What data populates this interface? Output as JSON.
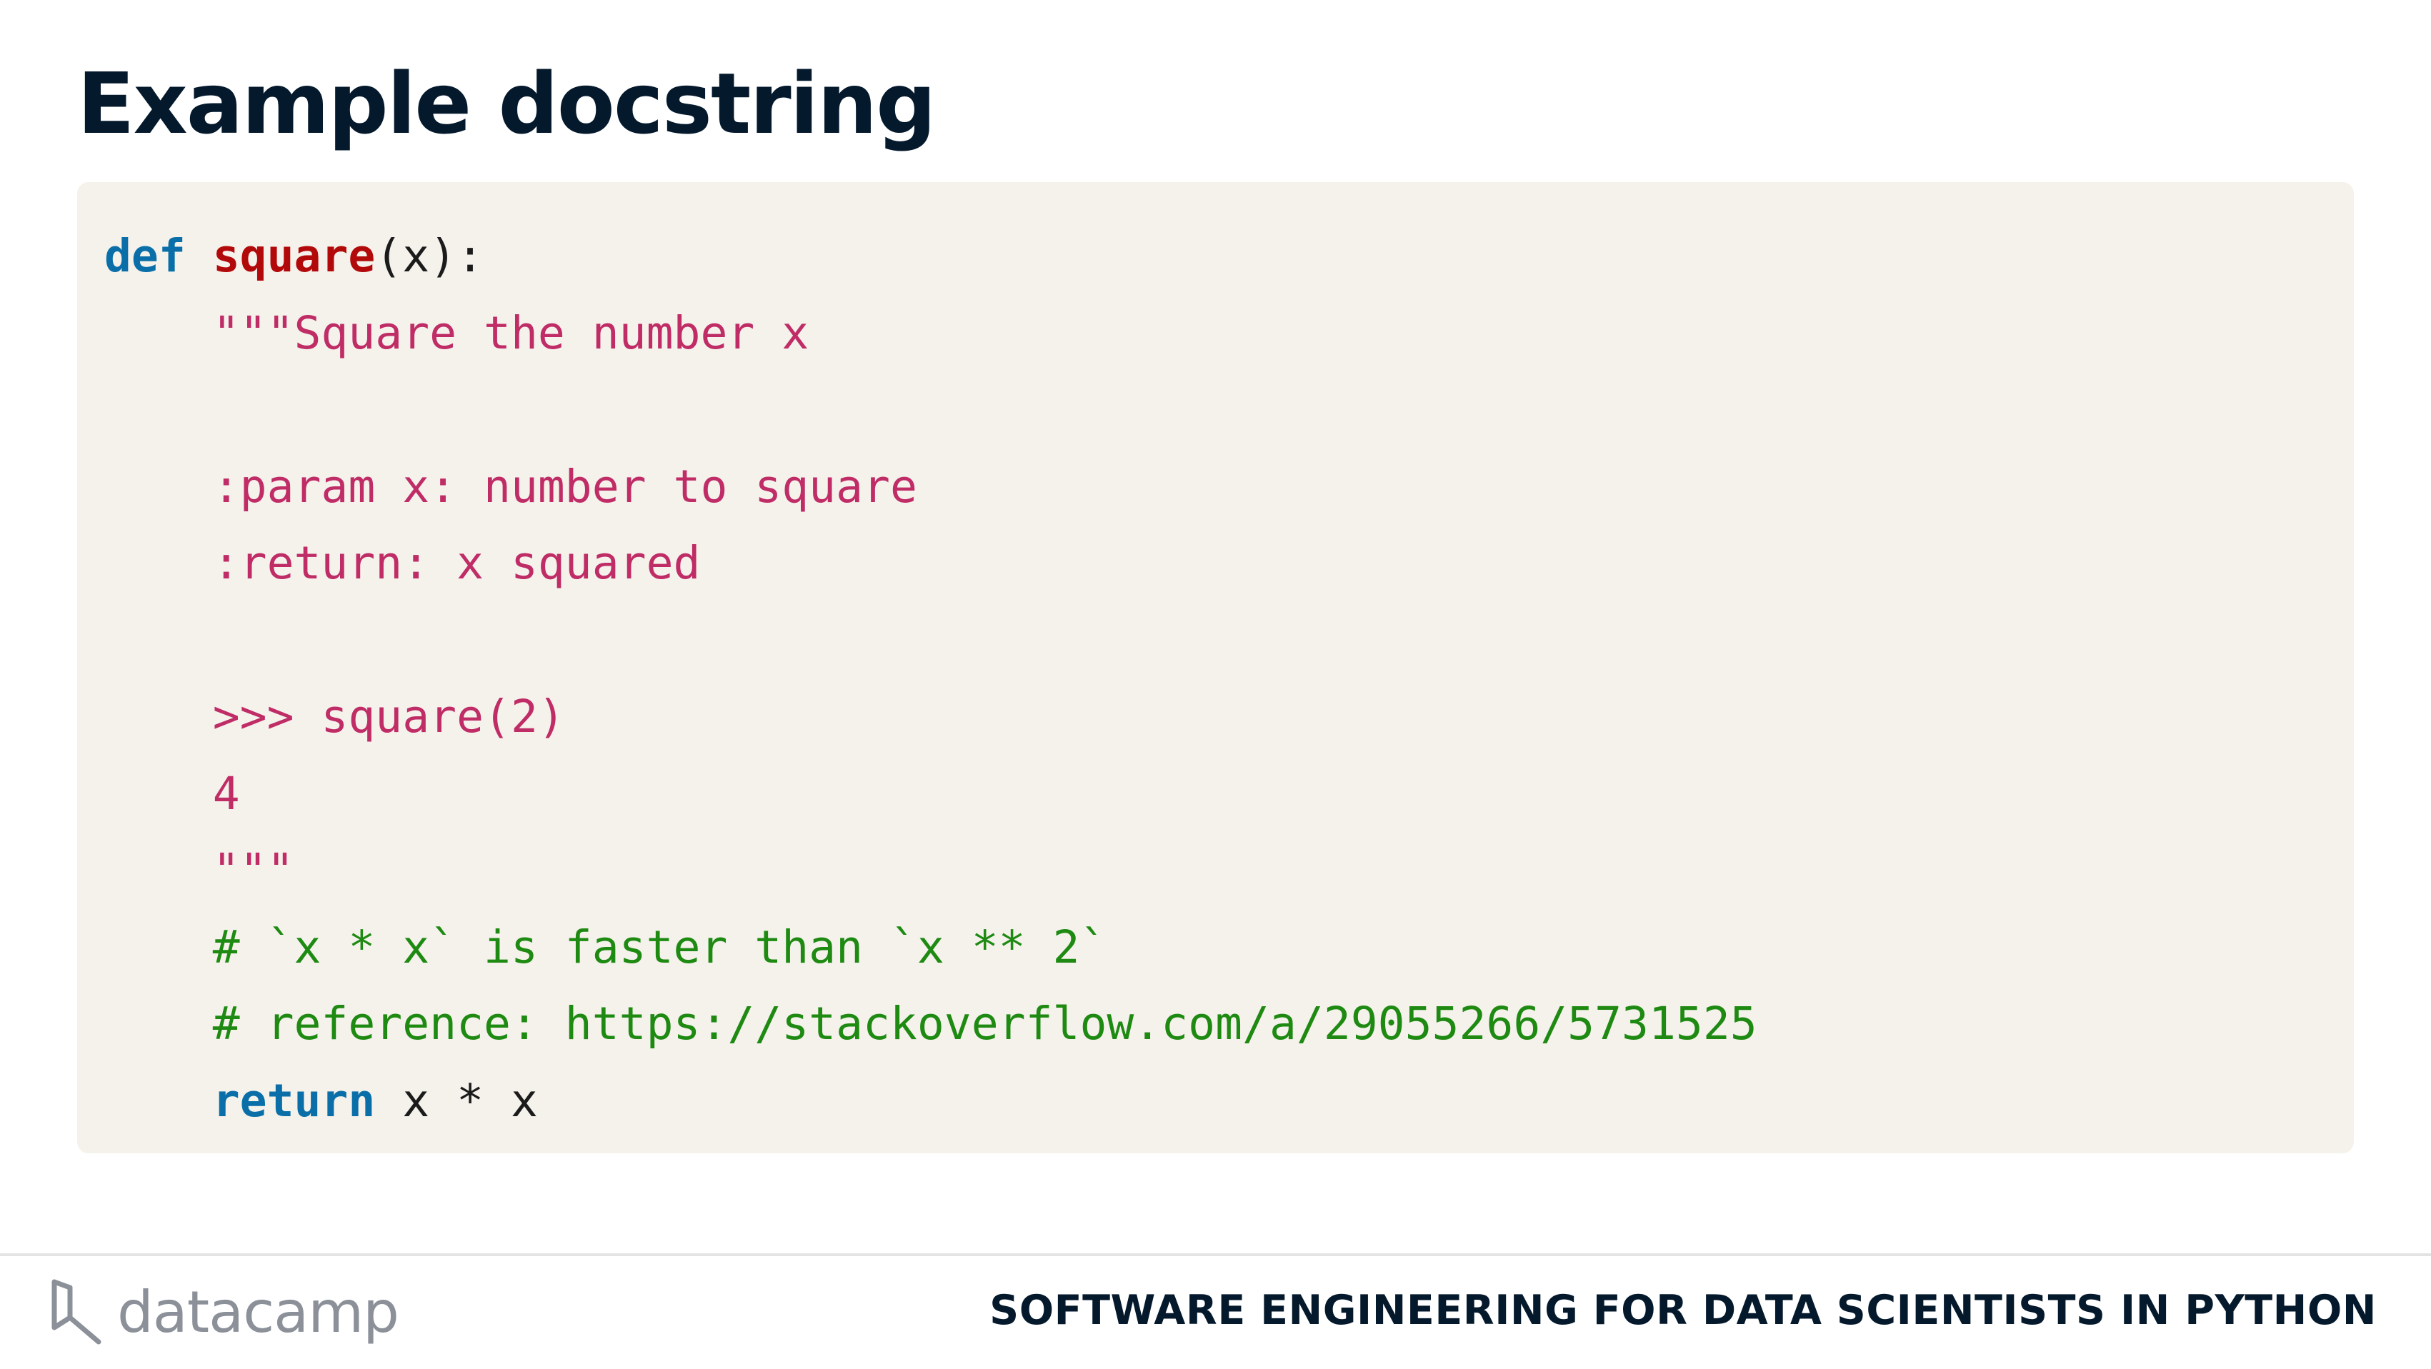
{
  "slide": {
    "title": "Example docstring"
  },
  "code": {
    "lines": [
      [
        {
          "type": "keyword",
          "text": "def"
        },
        {
          "type": "plain",
          "text": " "
        },
        {
          "type": "function",
          "text": "square"
        },
        {
          "type": "plain",
          "text": "(x):"
        }
      ],
      [
        {
          "type": "plain",
          "text": "    "
        },
        {
          "type": "string",
          "text": "\"\"\"Square the number x"
        }
      ],
      [],
      [
        {
          "type": "plain",
          "text": "    "
        },
        {
          "type": "string",
          "text": ":param x: number to square"
        }
      ],
      [
        {
          "type": "plain",
          "text": "    "
        },
        {
          "type": "string",
          "text": ":return: x squared"
        }
      ],
      [],
      [
        {
          "type": "plain",
          "text": "    "
        },
        {
          "type": "string",
          "text": ">>> square(2)"
        }
      ],
      [
        {
          "type": "plain",
          "text": "    "
        },
        {
          "type": "string",
          "text": "4"
        }
      ],
      [
        {
          "type": "plain",
          "text": "    "
        },
        {
          "type": "string",
          "text": "\"\"\""
        }
      ],
      [
        {
          "type": "plain",
          "text": "    "
        },
        {
          "type": "comment",
          "text": "# `x * x` is faster than `x ** 2`"
        }
      ],
      [
        {
          "type": "plain",
          "text": "    "
        },
        {
          "type": "comment",
          "text": "# reference: https://stackoverflow.com/a/29055266/5731525"
        }
      ],
      [
        {
          "type": "plain",
          "text": "    "
        },
        {
          "type": "keyword",
          "text": "return"
        },
        {
          "type": "plain",
          "text": " x * x"
        }
      ]
    ]
  },
  "footer": {
    "logo_text": "datacamp",
    "logo_icon": "datacamp-logo-icon",
    "course_title": "SOFTWARE ENGINEERING FOR DATA SCIENTISTS IN PYTHON"
  },
  "colors": {
    "title": "#05192d",
    "code_background": "#f5f2ec",
    "keyword": "#0a6fa8",
    "function": "#b20a0a",
    "string": "#bf2c66",
    "comment": "#1e8a12",
    "logo": "#8b9099"
  }
}
